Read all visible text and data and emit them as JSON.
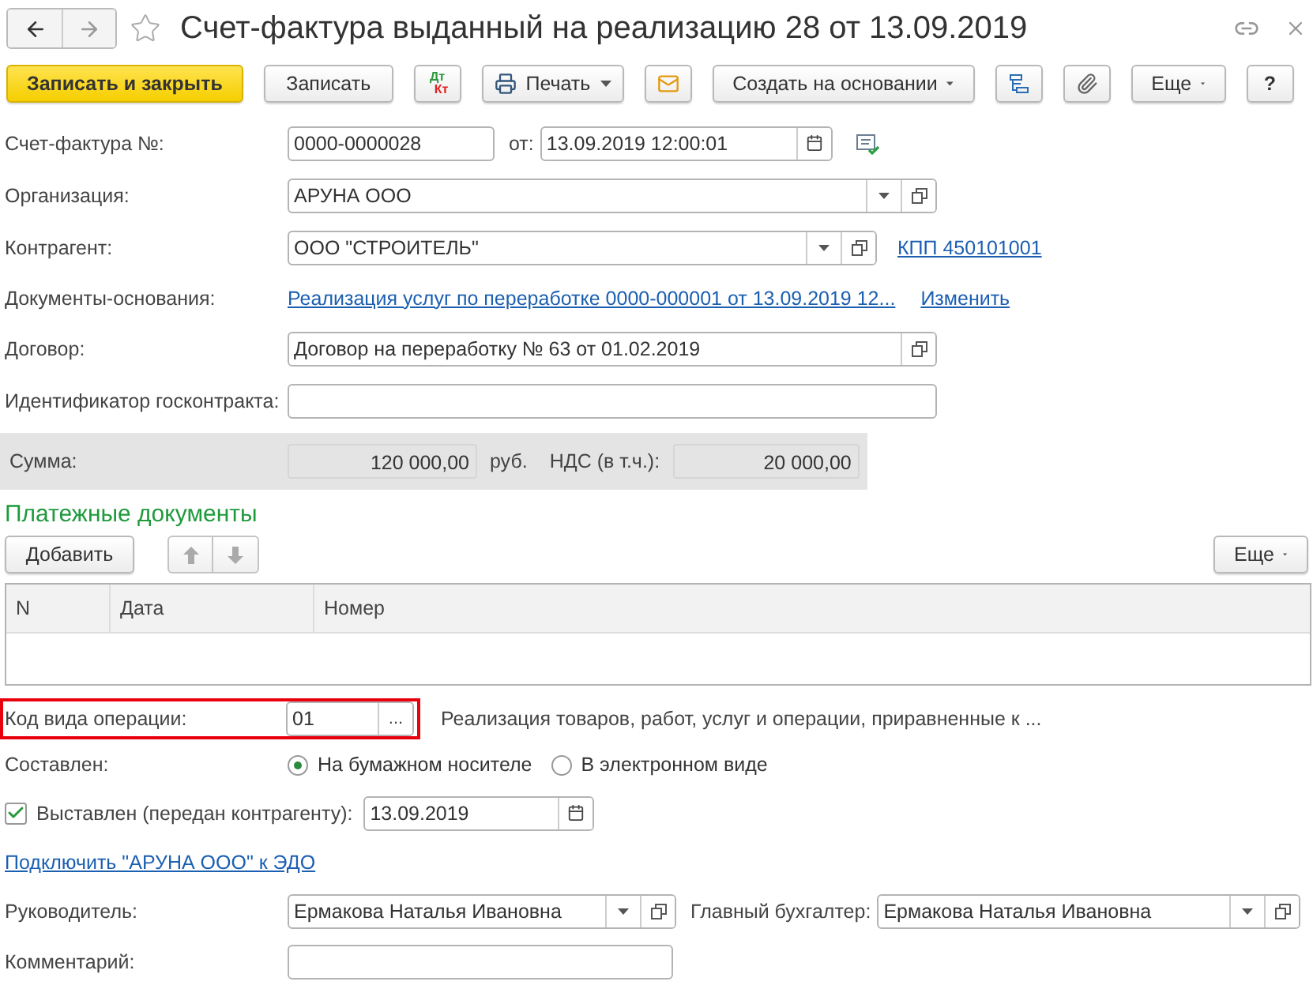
{
  "window": {
    "title": "Счет-фактура выданный на реализацию 28 от 13.09.2019"
  },
  "toolbar": [
    {
      "kind": "primary",
      "label": "Записать и закрыть"
    },
    {
      "kind": "plain",
      "label": "Записать"
    },
    {
      "kind": "dtkt",
      "top": "Дт",
      "bottom": "Кт"
    },
    {
      "kind": "print",
      "label": "Печать"
    },
    {
      "kind": "mail"
    },
    {
      "kind": "menu",
      "label": "Создать на основании"
    },
    {
      "kind": "structure"
    },
    {
      "kind": "clip"
    },
    {
      "kind": "menu",
      "label": "Еще"
    },
    {
      "kind": "plain",
      "label": "?"
    }
  ],
  "number": {
    "label": "Счет-фактура №:",
    "value": "0000-0000028",
    "date_label": "от:",
    "date": "13.09.2019 12:00:01"
  },
  "organization": {
    "label": "Организация:",
    "value": "АРУНА ООО"
  },
  "contractor": {
    "label": "Контрагент:",
    "value": "ООО \"СТРОИТЕЛЬ\"",
    "kpp_link": "КПП 450101001"
  },
  "base_documents": {
    "label": "Документы-основания:",
    "link": "Реализация услуг по переработке 0000-000001 от 13.09.2019 12...",
    "change_link": "Изменить"
  },
  "contract": {
    "label": "Договор:",
    "value": "Договор на переработку № 63 от 01.02.2019"
  },
  "gov_contract_id": {
    "label": "Идентификатор госконтракта:"
  },
  "sum": {
    "label": "Сумма:",
    "amount": "120 000,00",
    "currency": "руб.",
    "vat_label": "НДС (в т.ч.):",
    "vat": "20 000,00"
  },
  "payments": {
    "title": "Платежные документы",
    "add_button": "Добавить",
    "more_button": "Еще",
    "columns": [
      "N",
      "Дата",
      "Номер"
    ]
  },
  "operation_code": {
    "label": "Код вида операции:",
    "value": "01",
    "select_button": "...",
    "description": "Реализация товаров, работ, услуг и операции, приравненные к ...",
    "highlighted": true
  },
  "composed": {
    "label": "Составлен:",
    "options": [
      {
        "label": "На бумажном носителе",
        "selected": true
      },
      {
        "label": "В электронном виде",
        "selected": false
      }
    ]
  },
  "issued": {
    "label": "Выставлен (передан контрагенту):",
    "checked": true,
    "date": "13.09.2019"
  },
  "edo_link": "Подключить \"АРУНА ООО\" к ЭДО",
  "head": {
    "label": "Руководитель:",
    "value": "Ермакова Наталья Ивановна"
  },
  "chief_accountant": {
    "label": "Главный бухгалтер:",
    "value": "Ермакова Наталья Ивановна"
  },
  "comment": {
    "label": "Комментарий:"
  }
}
